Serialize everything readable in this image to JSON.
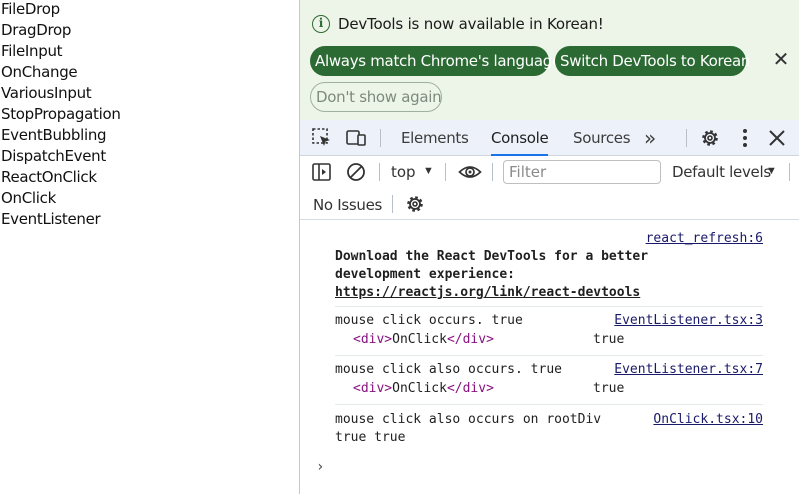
{
  "left_links": [
    "FileDrop",
    "DragDrop",
    "FileInput",
    "OnChange",
    "VariousInput",
    "StopPropagation",
    "EventBubbling",
    "DispatchEvent",
    "ReactOnClick",
    "OnClick",
    "EventListener"
  ],
  "infobar": {
    "message": "DevTools is now available in Korean!",
    "match_language_label": "Always match Chrome's language",
    "switch_label": "Switch DevTools to Korean",
    "dont_show_label": "Don't show again",
    "close_glyph": "✕"
  },
  "tabs": {
    "elements": "Elements",
    "console": "Console",
    "sources": "Sources",
    "more": "»"
  },
  "console_toolbar": {
    "context": "top",
    "filter_placeholder": "Filter",
    "levels": "Default levels"
  },
  "issues": {
    "label": "No Issues"
  },
  "console_messages": {
    "m1": {
      "source": "react_refresh:6",
      "line1": "Download the React DevTools for a better",
      "line2": "development experience:",
      "link": "https://reactjs.org/link/react-devtools"
    },
    "m2": {
      "text": "mouse click occurs. true",
      "source": "EventListener.tsx:3",
      "tag_open": "<div>",
      "tag_text": "OnClick",
      "tag_close": "</div>",
      "bool": "true"
    },
    "m3": {
      "text": "mouse click also occurs. true",
      "source": "EventListener.tsx:7",
      "tag_open": "<div>",
      "tag_text": "OnClick",
      "tag_close": "</div>",
      "bool": "true"
    },
    "m4": {
      "text": "mouse click also occurs on rootDiv",
      "source": "OnClick.tsx:10",
      "line2": "true true"
    }
  },
  "prompt_glyph": "›",
  "colors": {
    "infobar_bg": "#edf5e9",
    "button_green": "#2c6a34",
    "tab_active_underline": "#1a73e8",
    "tag_purple": "#881280"
  },
  "icons": [
    "inspect-element-icon",
    "device-toolbar-icon",
    "settings-gear-icon",
    "kebab-menu-icon",
    "close-icon",
    "sidebar-toggle-icon",
    "clear-console-icon",
    "eye-icon",
    "info-icon"
  ]
}
